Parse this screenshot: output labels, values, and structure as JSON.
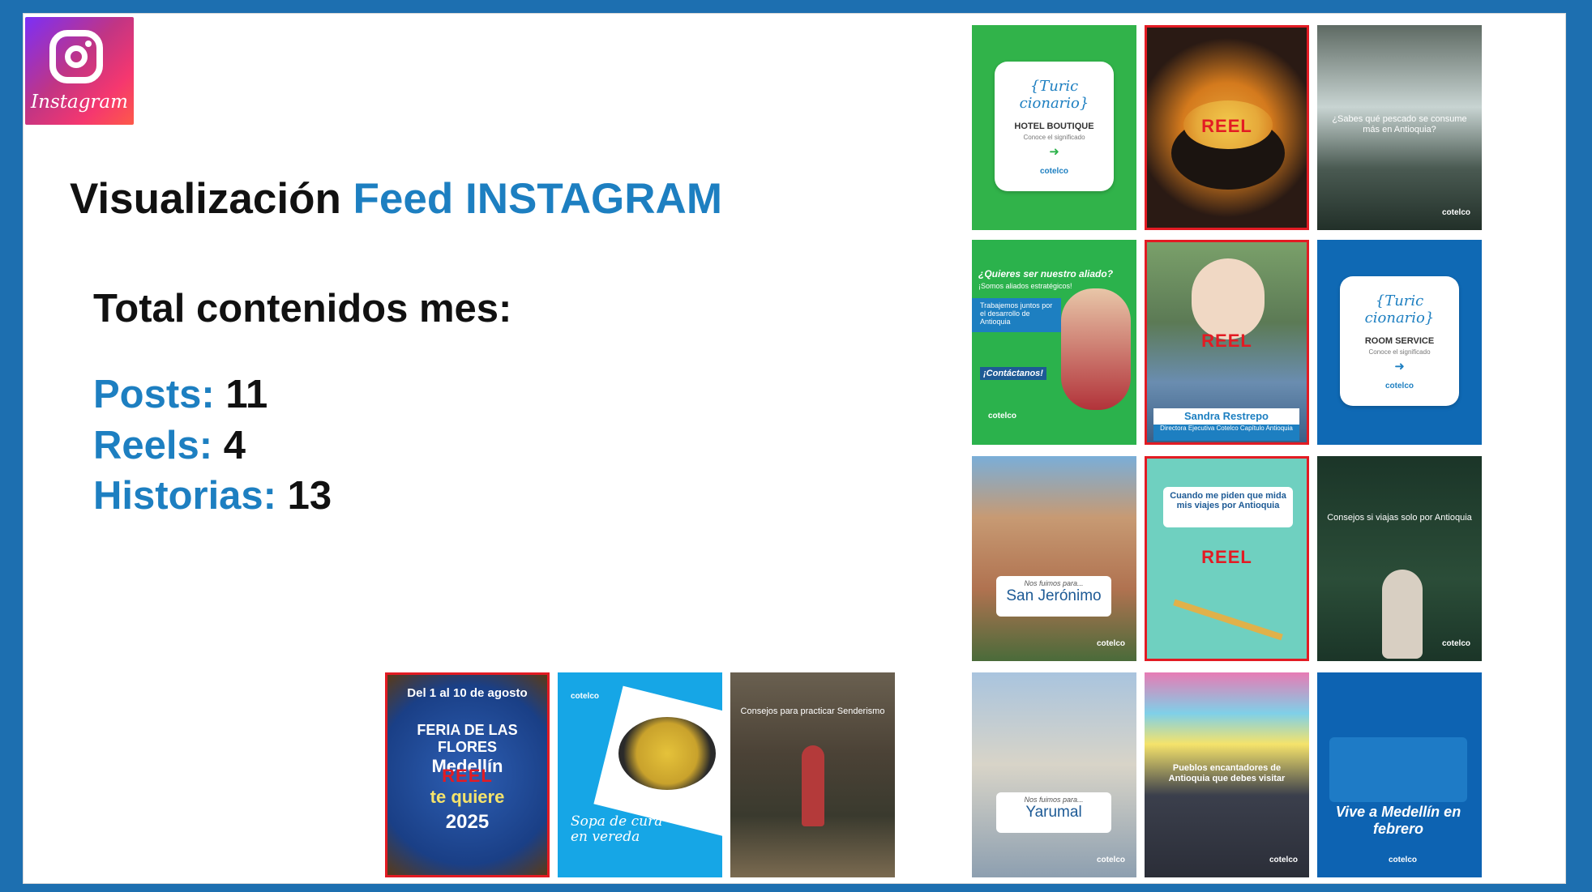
{
  "logo": {
    "text": "Instagram"
  },
  "title": {
    "main": "Visualización ",
    "accent": "Feed INSTAGRAM"
  },
  "summary": {
    "heading": "Total contenidos mes:",
    "posts_label": "Posts:",
    "posts_value": "11",
    "reels_label": "Reels:",
    "reels_value": "4",
    "stories_label": "Historias:",
    "stories_value": "13"
  },
  "reel_tag": "REEL",
  "feed": {
    "t1": {
      "brand": "{Turic cionario}",
      "name": "HOTEL BOUTIQUE",
      "sub": "Conoce el significado",
      "mark": "cotelco",
      "bg": "#31b34a"
    },
    "t2": {
      "bg": "#2a1a14"
    },
    "t3": {
      "text": "¿Sabes qué pescado se consume más en Antioquia?",
      "mark": "cotelco",
      "bg": "#3c4a45"
    },
    "t4": {
      "q": "¿Quieres ser nuestro aliado?",
      "q2": "¡Somos aliados estratégicos!",
      "body": "Trabajemos juntos por el desarrollo de Antioquia",
      "cta": "¡Contáctanos!",
      "mark": "cotelco",
      "bg": "#2bb24c"
    },
    "t5": {
      "person": "Sandra Restrepo",
      "role": "Directora Ejecutiva Cotelco Capítulo Antioquia",
      "bg": "#6d8f6a"
    },
    "t6": {
      "brand": "{Turic cionario}",
      "name": "ROOM SERVICE",
      "sub": "Conoce el significado",
      "mark": "cotelco",
      "bg": "#0f69b4"
    },
    "t7": {
      "pre": "Nos fuimos para...",
      "place": "San Jerónimo",
      "mark": "cotelco",
      "bg": "#b07250"
    },
    "t8": {
      "text": "Cuando me piden que mida mis viajes por Antioquia",
      "bg": "#6fd0c0"
    },
    "t9": {
      "text": "Consejos si viajas solo por Antioquia",
      "mark": "cotelco",
      "bg": "#1b3528"
    },
    "t10": {
      "pre": "Nos fuimos para...",
      "place": "Yarumal",
      "mark": "cotelco",
      "bg": "#8d9fb0"
    },
    "t11": {
      "text": "Pueblos encantadores de Antioquia que debes visitar",
      "mark": "cotelco",
      "bg": "#3b3f4c"
    },
    "t12": {
      "text": "Vive a Medellín en febrero",
      "mark": "cotelco",
      "bg": "#0d63b2"
    }
  },
  "bottom": {
    "b1": {
      "l1": "Del 1 al 10 de agosto",
      "l2": "FERIA DE LAS FLORES",
      "l3": "Medellín",
      "l4": "te quiere",
      "l5": "2025",
      "bg": "#1a3f86"
    },
    "b2": {
      "text": "Sopa de cura en vereda",
      "mark": "cotelco",
      "bg": "#16a6e6"
    },
    "b3": {
      "text": "Consejos para practicar Senderismo",
      "bg": "#4b4236"
    }
  }
}
